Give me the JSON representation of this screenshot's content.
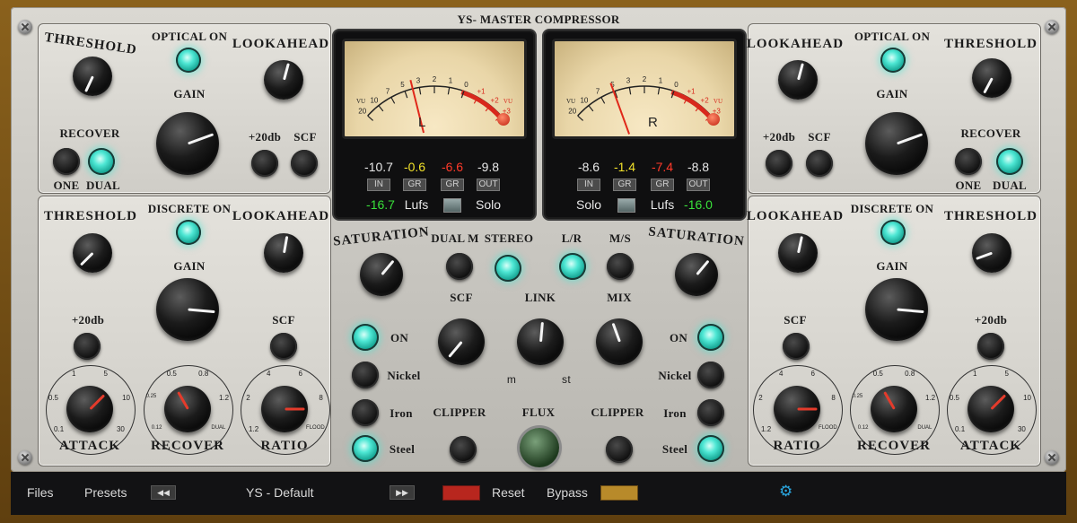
{
  "title": "YS- MASTER COMPRESSOR",
  "left_top": {
    "threshold": "THRESHOLD",
    "optical_on": "OPTICAL ON",
    "lookahead": "LOOKAHEAD",
    "gain": "GAIN",
    "recover": "RECOVER",
    "plus20db": "+20db",
    "scf": "SCF",
    "one": "ONE",
    "dual": "DUAL"
  },
  "left_bottom": {
    "threshold": "THRESHOLD",
    "discrete_on": "DISCRETE ON",
    "lookahead": "LOOKAHEAD",
    "gain": "GAIN",
    "plus20db": "+20db",
    "scf": "SCF",
    "attack": "ATTACK",
    "recover": "RECOVER",
    "ratio": "RATIO"
  },
  "right_top": {
    "lookahead": "LOOKAHEAD",
    "optical_on": "OPTICAL ON",
    "threshold": "THRESHOLD",
    "gain": "GAIN",
    "plus20db": "+20db",
    "scf": "SCF",
    "recover": "RECOVER",
    "one": "ONE",
    "dual": "DUAL"
  },
  "right_bottom": {
    "lookahead": "LOOKAHEAD",
    "discrete_on": "DISCRETE ON",
    "threshold": "THRESHOLD",
    "gain": "GAIN",
    "scf": "SCF",
    "plus20db": "+20db",
    "ratio": "RATIO",
    "recover": "RECOVER",
    "attack": "ATTACK"
  },
  "attack_scale": [
    "0.1",
    "0.5",
    "1",
    "5",
    "10",
    "30"
  ],
  "recover_scale": [
    "0.12",
    "0.25",
    "0.5",
    "0.8",
    "1.2",
    "DUAL"
  ],
  "ratio_scale": [
    "1.2",
    "2",
    "4",
    "6",
    "8",
    "FLOOD"
  ],
  "meter_scale": [
    "20",
    "10",
    "7",
    "5",
    "3",
    "2",
    "1",
    "0",
    "+1",
    "+2",
    "+3"
  ],
  "meter_vu": "VU",
  "meter_left": {
    "channel": "L",
    "in": "-10.7",
    "gr1": "-0.6",
    "gr2": "-6.6",
    "out": "-9.8",
    "lufs_value": "-16.7",
    "lufs": "Lufs",
    "solo": "Solo"
  },
  "meter_right": {
    "channel": "R",
    "in": "-8.6",
    "gr1": "-1.4",
    "gr2": "-7.4",
    "out": "-8.8",
    "lufs_value": "-16.0",
    "lufs": "Lufs",
    "solo": "Solo"
  },
  "meter_tags": {
    "in": "IN",
    "gr": "GR",
    "out": "OUT"
  },
  "center": {
    "saturation": "SATURATION",
    "dual_m": "DUAL M",
    "stereo": "STEREO",
    "lr": "L/R",
    "ms": "M/S",
    "scf": "SCF",
    "link": "LINK",
    "mix": "MIX",
    "m": "m",
    "st": "st",
    "on": "ON",
    "nickel": "Nickel",
    "iron": "Iron",
    "steel": "Steel",
    "clipper": "CLIPPER",
    "flux": "FLUX"
  },
  "footer": {
    "files": "Files",
    "presets": "Presets",
    "preset_name": "YS - Default",
    "reset": "Reset",
    "bypass": "Bypass"
  },
  "colors": {
    "led": "#4ee7d4",
    "gr_yellow": "#f2e22a",
    "gr_red": "#ff3a2a",
    "lufs_green": "#39e03a",
    "reset_red": "#b8261e",
    "bypass_amber": "#b88a2a",
    "gear_blue": "#2aa7e0"
  },
  "icons": {
    "prev": "rewind-icon",
    "next": "fast-forward-icon",
    "settings": "gear-icon"
  }
}
